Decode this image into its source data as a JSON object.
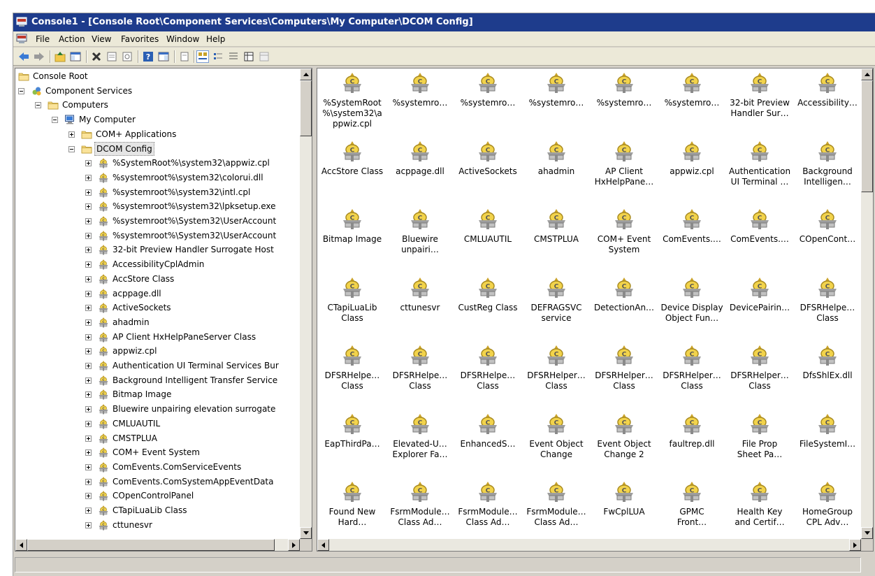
{
  "window": {
    "title": "Console1 - [Console Root\\Component Services\\Computers\\My Computer\\DCOM Config]"
  },
  "menu": [
    "File",
    "Action",
    "View",
    "Favorites",
    "Window",
    "Help"
  ],
  "toolbar": {
    "buttons": [
      "back-icon",
      "forward-icon",
      "up-folder-icon",
      "show-hide-tree-icon",
      "delete-icon",
      "properties-icon",
      "refresh-icon",
      "help-icon",
      "show-hide-action-pane-icon",
      "export-list-icon",
      "large-icons-view-icon",
      "small-icons-view-icon",
      "list-view-icon",
      "detail-view-icon",
      "configure-icon"
    ]
  },
  "tree": {
    "nodes": [
      {
        "label": "Console Root",
        "level": 0,
        "expander": "none",
        "icon": "folder-icon"
      },
      {
        "label": "Component Services",
        "level": 0,
        "expander": "minus",
        "icon": "component-services-icon"
      },
      {
        "label": "Computers",
        "level": 1,
        "expander": "minus",
        "icon": "folder-icon"
      },
      {
        "label": "My Computer",
        "level": 2,
        "expander": "minus",
        "icon": "computer-icon"
      },
      {
        "label": "COM+ Applications",
        "level": 3,
        "expander": "plus",
        "icon": "folder-icon"
      },
      {
        "label": "DCOM Config",
        "level": 3,
        "expander": "minus",
        "icon": "folder-icon",
        "selected": true
      },
      {
        "label": "%SystemRoot%\\system32\\appwiz.cpl",
        "level": 4,
        "expander": "plus",
        "icon": "dcom-app-icon"
      },
      {
        "label": "%systemroot%\\system32\\colorui.dll",
        "level": 4,
        "expander": "plus",
        "icon": "dcom-app-icon"
      },
      {
        "label": "%systemroot%\\system32\\intl.cpl",
        "level": 4,
        "expander": "plus",
        "icon": "dcom-app-icon"
      },
      {
        "label": "%systemroot%\\system32\\lpksetup.exe",
        "level": 4,
        "expander": "plus",
        "icon": "dcom-app-icon"
      },
      {
        "label": "%systemroot%\\System32\\UserAccount",
        "level": 4,
        "expander": "plus",
        "icon": "dcom-app-icon"
      },
      {
        "label": "%systemroot%\\System32\\UserAccount",
        "level": 4,
        "expander": "plus",
        "icon": "dcom-app-icon"
      },
      {
        "label": "32-bit Preview Handler Surrogate Host",
        "level": 4,
        "expander": "plus",
        "icon": "dcom-app-icon"
      },
      {
        "label": "AccessibilityCplAdmin",
        "level": 4,
        "expander": "plus",
        "icon": "dcom-app-icon"
      },
      {
        "label": "AccStore Class",
        "level": 4,
        "expander": "plus",
        "icon": "dcom-app-icon"
      },
      {
        "label": "acppage.dll",
        "level": 4,
        "expander": "plus",
        "icon": "dcom-app-icon"
      },
      {
        "label": "ActiveSockets",
        "level": 4,
        "expander": "plus",
        "icon": "dcom-app-icon"
      },
      {
        "label": "ahadmin",
        "level": 4,
        "expander": "plus",
        "icon": "dcom-app-icon"
      },
      {
        "label": "AP Client HxHelpPaneServer Class",
        "level": 4,
        "expander": "plus",
        "icon": "dcom-app-icon"
      },
      {
        "label": "appwiz.cpl",
        "level": 4,
        "expander": "plus",
        "icon": "dcom-app-icon"
      },
      {
        "label": "Authentication UI Terminal Services Bur",
        "level": 4,
        "expander": "plus",
        "icon": "dcom-app-icon"
      },
      {
        "label": "Background Intelligent Transfer Service",
        "level": 4,
        "expander": "plus",
        "icon": "dcom-app-icon"
      },
      {
        "label": "Bitmap Image",
        "level": 4,
        "expander": "plus",
        "icon": "dcom-app-icon"
      },
      {
        "label": "Bluewire unpairing elevation surrogate",
        "level": 4,
        "expander": "plus",
        "icon": "dcom-app-icon"
      },
      {
        "label": "CMLUAUTIL",
        "level": 4,
        "expander": "plus",
        "icon": "dcom-app-icon"
      },
      {
        "label": "CMSTPLUA",
        "level": 4,
        "expander": "plus",
        "icon": "dcom-app-icon"
      },
      {
        "label": "COM+ Event System",
        "level": 4,
        "expander": "plus",
        "icon": "dcom-app-icon"
      },
      {
        "label": "ComEvents.ComServiceEvents",
        "level": 4,
        "expander": "plus",
        "icon": "dcom-app-icon"
      },
      {
        "label": "ComEvents.ComSystemAppEventData",
        "level": 4,
        "expander": "plus",
        "icon": "dcom-app-icon"
      },
      {
        "label": "COpenControlPanel",
        "level": 4,
        "expander": "plus",
        "icon": "dcom-app-icon"
      },
      {
        "label": "CTapiLuaLib Class",
        "level": 4,
        "expander": "plus",
        "icon": "dcom-app-icon"
      },
      {
        "label": "cttunesvr",
        "level": 4,
        "expander": "plus",
        "icon": "dcom-app-icon"
      }
    ]
  },
  "pane": {
    "items": [
      "%SystemRoot\n%\\system32\\a\nppwiz.cpl",
      "%systemro…",
      "%systemro…",
      "%systemro…",
      "%systemro…",
      "%systemro…",
      "32-bit Preview\nHandler Sur…",
      "Accessibility…",
      "AccStore Class",
      "acppage.dll",
      "ActiveSockets",
      "ahadmin",
      "AP Client\nHxHelpPane…",
      "appwiz.cpl",
      "Authentication\nUI Terminal …",
      "Background\nIntelligen…",
      "Bitmap Image",
      "Bluewire\nunpairi…",
      "CMLUAUTIL",
      "CMSTPLUA",
      "COM+ Event\nSystem",
      "ComEvents.…",
      "ComEvents.…",
      "COpenCont…",
      "CTapiLuaLib\nClass",
      "cttunesvr",
      "CustReg Class",
      "DEFRAGSVC\nservice",
      "DetectionAn…",
      "Device Display\nObject Fun…",
      "DevicePairin…",
      "DFSRHelpe…\nClass",
      "DFSRHelpe…\nClass",
      "DFSRHelpe…\nClass",
      "DFSRHelpe…\nClass",
      "DFSRHelper…\nClass",
      "DFSRHelper…\nClass",
      "DFSRHelper…\nClass",
      "DFSRHelper…\nClass",
      "DfsShlEx.dll",
      "EapThirdPa…",
      "Elevated-U…\nExplorer Fa…",
      "EnhancedS…",
      "Event Object\nChange",
      "Event Object\nChange 2",
      "faultrep.dll",
      "File Prop\nSheet Pa…",
      "FileSystemI…",
      "Found New\nHard…",
      "FsrmModule…\nClass Ad…",
      "FsrmModule…\nClass Ad…",
      "FsrmModule…\nClass Ad…",
      "FwCplLUA",
      "GPMC\nFront…",
      "Health Key\nand Certif…",
      "HomeGroup\nCPL Adv…"
    ]
  },
  "statusbar": {
    "text": ""
  }
}
